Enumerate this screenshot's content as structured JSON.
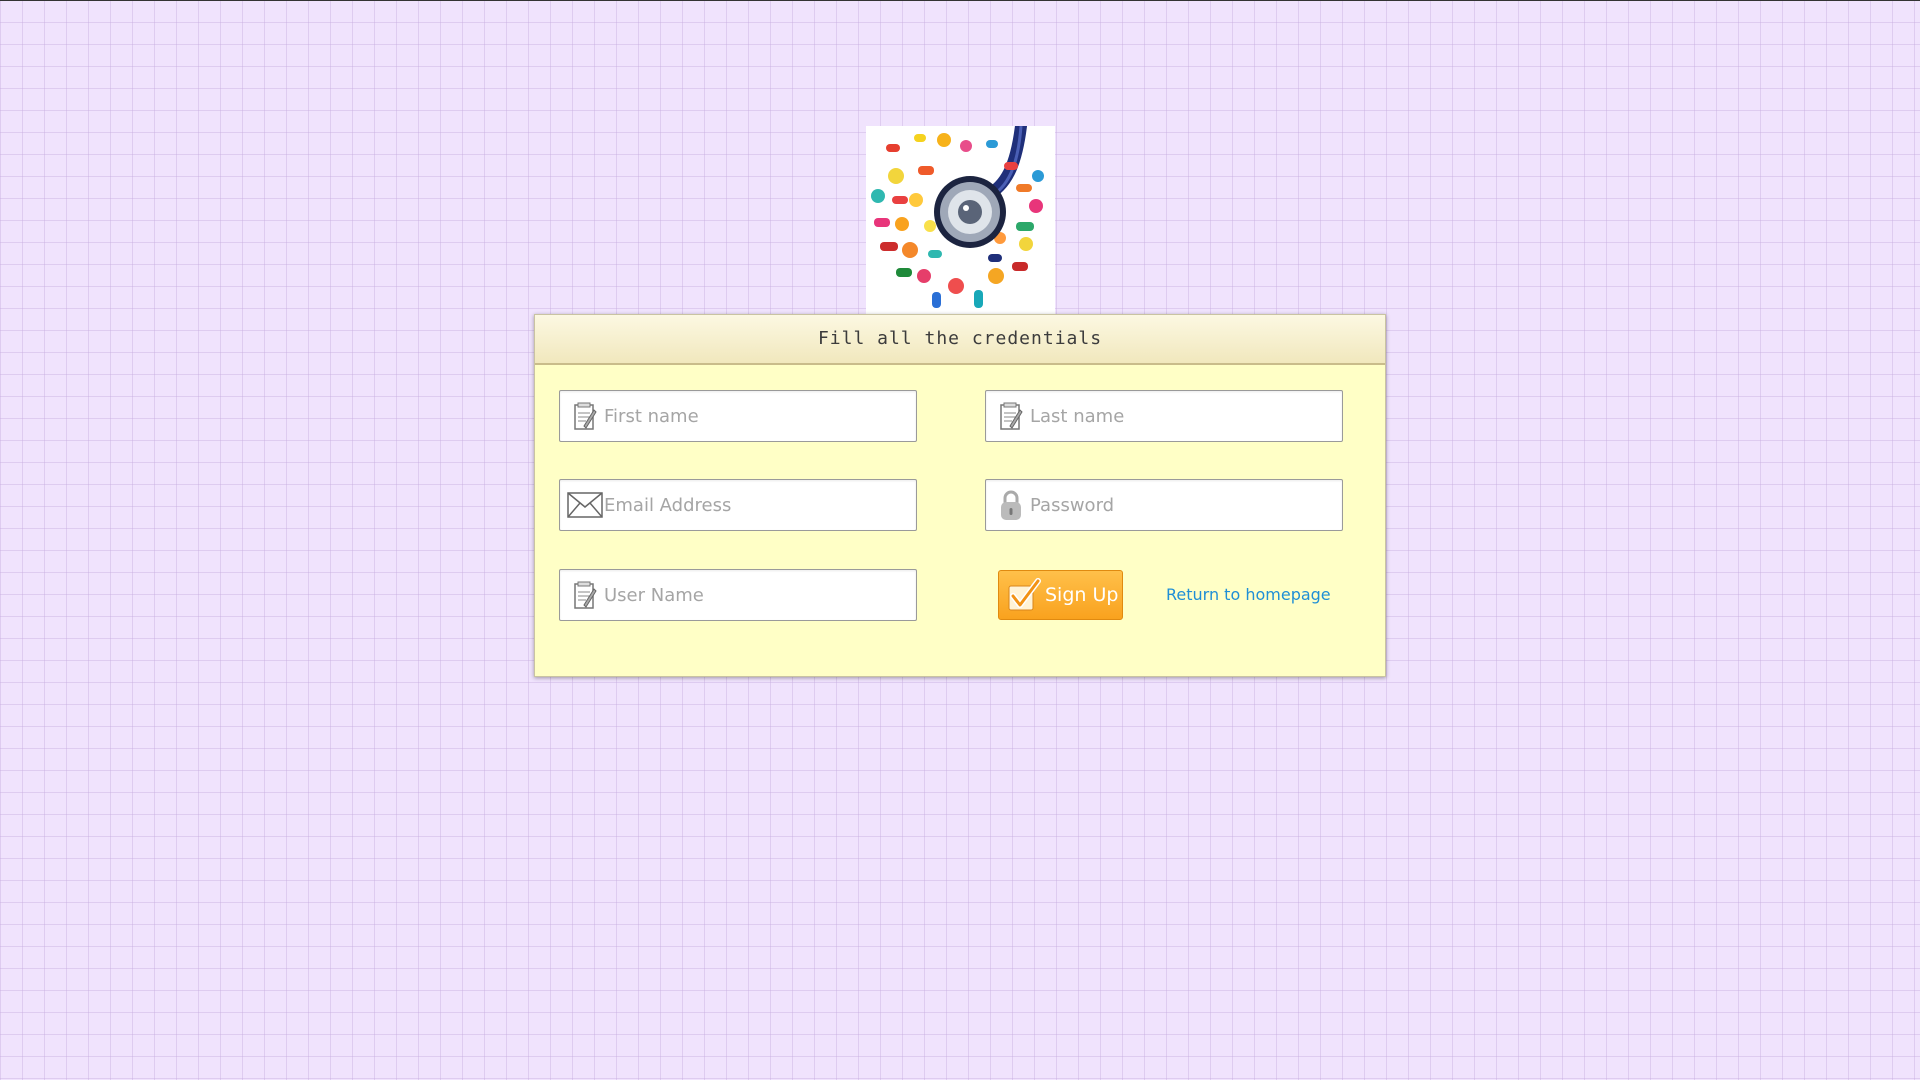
{
  "logo": {
    "icon": "stethoscope-pills-logo"
  },
  "form": {
    "title": "Fill all the credentials",
    "fields": {
      "first_name": {
        "placeholder": "First name",
        "value": "",
        "icon": "notepad-icon"
      },
      "last_name": {
        "placeholder": "Last name",
        "value": "",
        "icon": "notepad-icon"
      },
      "email": {
        "placeholder": "Email Address",
        "value": "",
        "icon": "envelope-icon"
      },
      "password": {
        "placeholder": "Password",
        "value": "",
        "icon": "lock-icon"
      },
      "username": {
        "placeholder": "User Name",
        "value": "",
        "icon": "notepad-icon"
      }
    },
    "signup_label": "Sign Up",
    "home_link": "Return to homepage"
  },
  "colors": {
    "background": "#f0e3fd",
    "panel": "#ffffc6",
    "button": "#f9a21e",
    "link": "#1f8fd6"
  }
}
